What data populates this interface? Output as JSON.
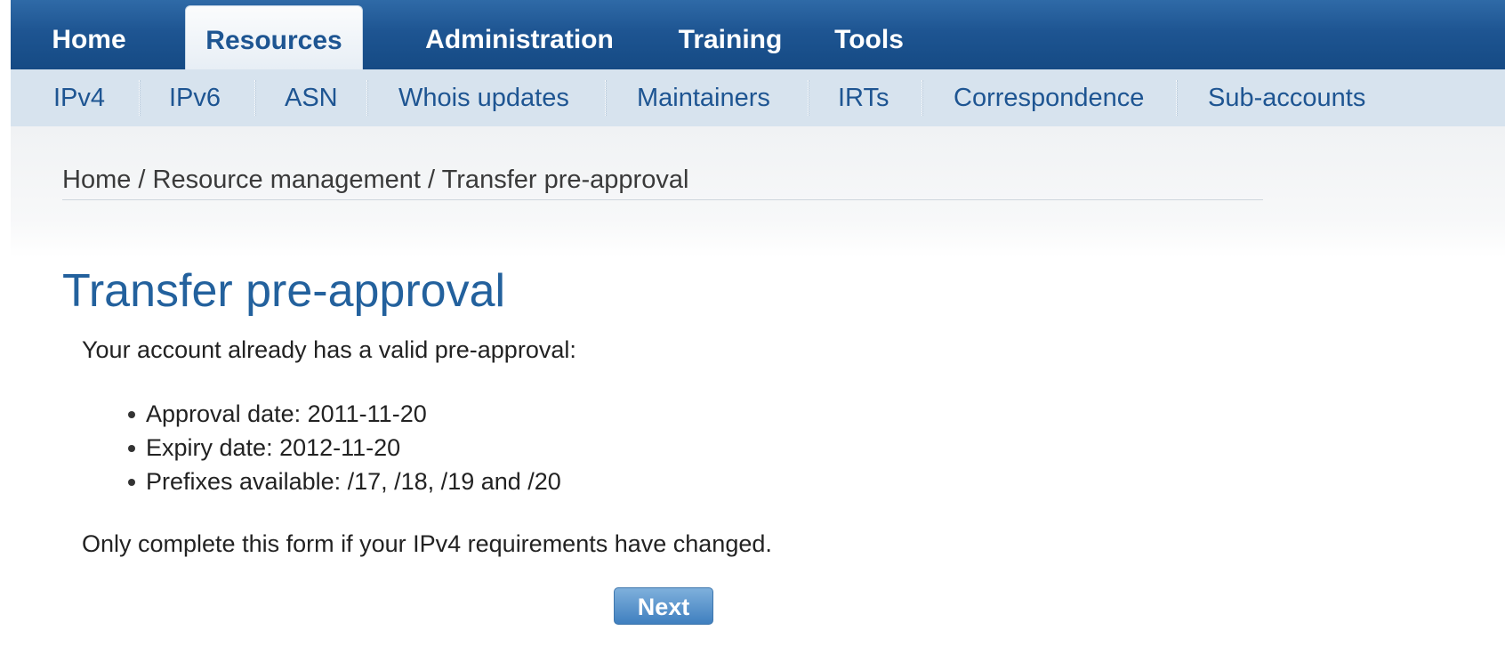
{
  "top_nav": {
    "tabs": [
      {
        "label": "Home"
      },
      {
        "label": "Resources",
        "active": true
      },
      {
        "label": "Administration"
      },
      {
        "label": "Training"
      },
      {
        "label": "Tools"
      }
    ]
  },
  "sub_nav": {
    "items": [
      {
        "label": "IPv4"
      },
      {
        "label": "IPv6"
      },
      {
        "label": "ASN"
      },
      {
        "label": "Whois updates"
      },
      {
        "label": "Maintainers"
      },
      {
        "label": "IRTs"
      },
      {
        "label": "Correspondence"
      },
      {
        "label": "Sub-accounts"
      }
    ]
  },
  "breadcrumb": {
    "home": "Home",
    "sep": " / ",
    "section": "Resource management",
    "current": "Transfer pre-approval"
  },
  "page": {
    "title": "Transfer pre-approval",
    "intro": "Your account already has a valid pre-approval:",
    "details": [
      "Approval date: 2011-11-20",
      "Expiry date: 2012-11-20",
      "Prefixes available: /17, /18, /19 and /20"
    ],
    "note": "Only complete this form if your IPv4 requirements have changed.",
    "next_label": "Next"
  },
  "colors": {
    "nav_blue": "#1e5592",
    "subnav_bg": "#d7e3ee",
    "title_blue": "#23619d",
    "button_blue": "#3f7fbf"
  }
}
